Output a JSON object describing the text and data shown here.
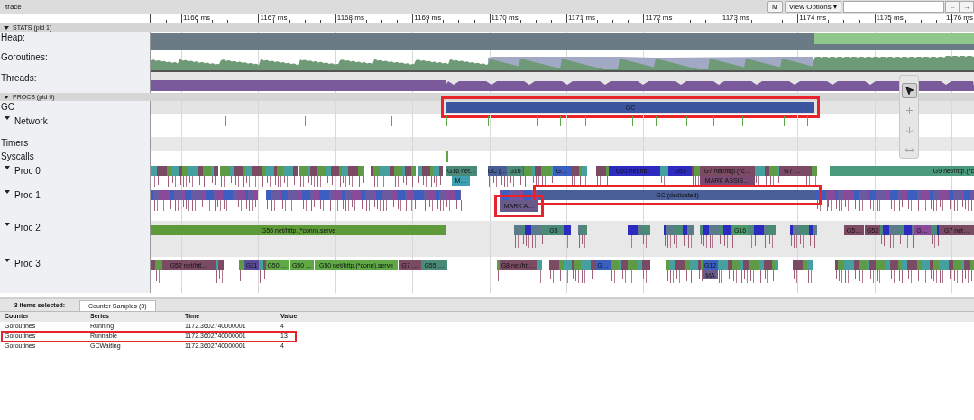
{
  "window": {
    "title": "trace"
  },
  "toolbar": {
    "buttons": [
      {
        "label": "M"
      },
      {
        "label": "View Options ▾"
      }
    ],
    "nav_buttons": [
      "←",
      "→"
    ]
  },
  "ruler": {
    "ticks": [
      "1166 ms",
      "1167 ms",
      "1168 ms",
      "1169 ms",
      "1170 ms",
      "1171 ms",
      "1172 ms",
      "1173 ms",
      "1174 ms",
      "1175 ms",
      "1176 ms"
    ]
  },
  "sections": [
    {
      "title": "STATS (pid 1)",
      "expanded": true,
      "tracks": [
        {
          "label": "Heap:",
          "kind": "heap"
        },
        {
          "label": "Goroutines:",
          "kind": "goroutines"
        },
        {
          "label": "Threads:",
          "kind": "threads"
        }
      ]
    },
    {
      "title": "PROCS (pid 0)",
      "expanded": true,
      "tracks": [
        {
          "label": "GC",
          "kind": "gc",
          "slices": [
            {
              "label": "GC",
              "color": "#3b55a0",
              "highlighted": true
            }
          ]
        },
        {
          "label": "Network",
          "kind": "network",
          "expanded": true
        },
        {
          "label": "Timers",
          "kind": "timers"
        },
        {
          "label": "Syscalls",
          "kind": "syscalls"
        },
        {
          "label": "Proc 0",
          "kind": "proc",
          "expanded": true,
          "slices": [
            {
              "label": "G16 net…",
              "color": "#4c8a78",
              "highlighted": false
            },
            {
              "label": "GC (…",
              "color": "#4a5f98",
              "highlighted": false
            },
            {
              "label": "G16",
              "color": "#4c8a78",
              "highlighted": false
            },
            {
              "label": "G…",
              "color": "#3b5fc0",
              "highlighted": false
            },
            {
              "label": "G51 net/htt…",
              "color": "#2d2bbf",
              "highlighted": false
            },
            {
              "label": "G51",
              "color": "#2d2bbf",
              "highlighted": false
            },
            {
              "label": "G7 net/http.(*c…",
              "color": "#7b4a63",
              "highlighted": false
            },
            {
              "label": "G7 …",
              "color": "#7b4a63",
              "highlighted": false
            },
            {
              "label": "G9 net/http.(*c",
              "color": "#4c9a7c",
              "highlighted": false
            }
          ],
          "sub_slices": [
            {
              "label": "M…",
              "color": "#3fa0b0",
              "highlighted": false
            },
            {
              "label": "MARK ASSIS…",
              "color": "#7b4a73",
              "highlighted": false
            }
          ]
        },
        {
          "label": "Proc 1",
          "kind": "proc",
          "expanded": true,
          "slices": [
            {
              "label": "GC (dedicated)",
              "color": "#4a5f98",
              "highlighted": true
            }
          ],
          "sub_slices": [
            {
              "label": "MARK A…",
              "color": "#6a5a8a",
              "highlighted": true
            }
          ]
        },
        {
          "label": "Proc 2",
          "kind": "proc",
          "expanded": true,
          "slices": [
            {
              "label": "G56 net/http.(*conn).serve",
              "color": "#5f9a3a",
              "highlighted": false
            },
            {
              "label": "G5",
              "color": "#4c8a78",
              "highlighted": false
            },
            {
              "label": "G16",
              "color": "#4c9a6c",
              "highlighted": false
            },
            {
              "label": "G5…",
              "color": "#7b4a63",
              "highlighted": false
            },
            {
              "label": "G52",
              "color": "#7b4a63",
              "highlighted": false
            },
            {
              "label": "G…",
              "color": "#8a4a9a",
              "highlighted": false
            },
            {
              "label": "G7 net…",
              "color": "#7b4a63",
              "highlighted": false
            }
          ]
        },
        {
          "label": "Proc 3",
          "kind": "proc",
          "expanded": true,
          "slices": [
            {
              "label": "G52 net/htt…",
              "color": "#7b4a63",
              "highlighted": false
            },
            {
              "label": "G11",
              "color": "#5a4a9a",
              "highlighted": false
            },
            {
              "label": "G50 …",
              "color": "#5fa845",
              "highlighted": false
            },
            {
              "label": "G50 …",
              "color": "#5fa845",
              "highlighted": false
            },
            {
              "label": "G50 net/http.(*conn).serve",
              "color": "#5fa845",
              "highlighted": false
            },
            {
              "label": "G7 …",
              "color": "#7b4a63",
              "highlighted": false
            },
            {
              "label": "G55 …",
              "color": "#4c8a78",
              "highlighted": false
            },
            {
              "label": "G8 net/htt…",
              "color": "#7b4a63",
              "highlighted": false
            },
            {
              "label": "G…",
              "color": "#3b5fc0",
              "highlighted": false
            },
            {
              "label": "G12",
              "color": "#3b5fc0",
              "highlighted": false
            }
          ],
          "sub_slices": [
            {
              "label": "MA",
              "color": "#6a5a8a",
              "highlighted": false
            }
          ]
        }
      ]
    }
  ],
  "tool_palette": {
    "tools": [
      {
        "kind": "select",
        "selected": true
      },
      {
        "kind": "zoom",
        "selected": false
      },
      {
        "kind": "pan",
        "selected": false
      },
      {
        "kind": "timing",
        "selected": false
      }
    ]
  },
  "selection": {
    "summary": "3 items selected:",
    "tabs": [
      {
        "label": "Counter Samples (3)",
        "selected": true
      }
    ],
    "table": {
      "columns": [
        "Counter",
        "Series",
        "Time",
        "Value"
      ],
      "rows": [
        {
          "cells": [
            "Goroutines",
            "Running",
            "1172.3602740000001",
            "4"
          ],
          "highlighted": false
        },
        {
          "cells": [
            "Goroutines",
            "Runnable",
            "1172.3602740000001",
            "13"
          ],
          "highlighted": true
        },
        {
          "cells": [
            "Goroutines",
            "GCWaiting",
            "1172.3602740000001",
            "4"
          ],
          "highlighted": false
        }
      ]
    }
  }
}
